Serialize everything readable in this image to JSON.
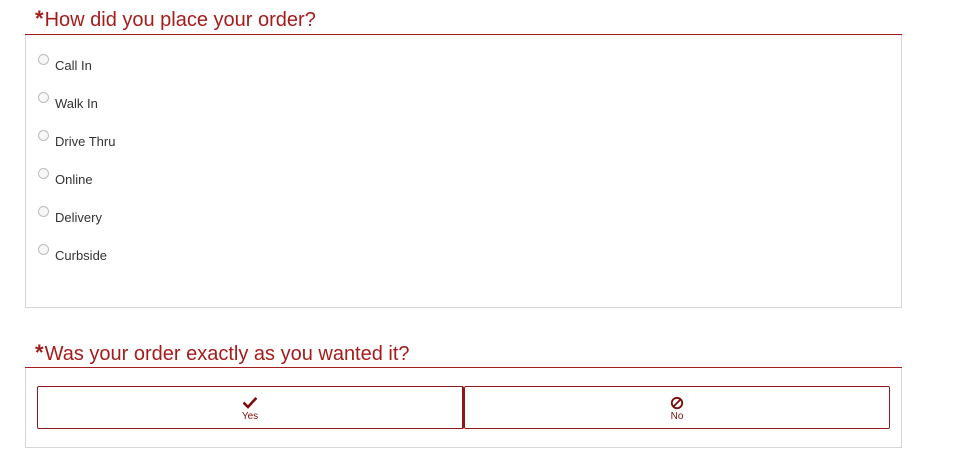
{
  "questions": [
    {
      "required_mark": "*",
      "title": "How did you place your order?",
      "options": [
        "Call In",
        "Walk In",
        "Drive Thru",
        "Online",
        "Delivery",
        "Curbside"
      ]
    },
    {
      "required_mark": "*",
      "title": "Was your order exactly as you wanted it?",
      "buttons": [
        {
          "label": "Yes",
          "icon": "check-icon"
        },
        {
          "label": "No",
          "icon": "no-symbol-icon"
        }
      ]
    }
  ],
  "colors": {
    "accent": "#a51c1c",
    "button_border": "#8b1a1a",
    "panel_border": "#d6d6d6",
    "text": "#333333"
  }
}
